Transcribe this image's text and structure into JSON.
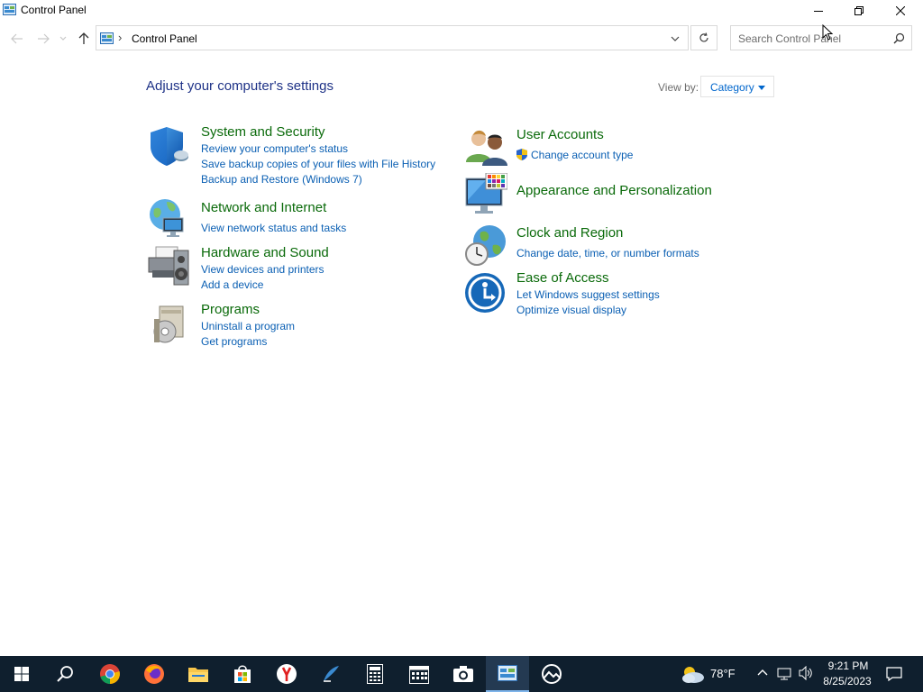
{
  "window": {
    "title": "Control Panel"
  },
  "address": {
    "separator": "›",
    "path": "Control Panel"
  },
  "search": {
    "placeholder": "Search Control Panel"
  },
  "content": {
    "heading": "Adjust your computer's settings",
    "view_by_label": "View by:",
    "view_by_value": "Category"
  },
  "categories": [
    {
      "title": "System and Security",
      "icon": "shield-icon",
      "links": [
        "Review your computer's status",
        "Save backup copies of your files with File History",
        "Backup and Restore (Windows 7)"
      ]
    },
    {
      "title": "Network and Internet",
      "icon": "network-globe-icon",
      "links": [
        "View network status and tasks"
      ]
    },
    {
      "title": "Hardware and Sound",
      "icon": "printer-speaker-icon",
      "links": [
        "View devices and printers",
        "Add a device"
      ]
    },
    {
      "title": "Programs",
      "icon": "programs-disc-icon",
      "links": [
        "Uninstall a program",
        "Get programs"
      ]
    },
    {
      "title": "User Accounts",
      "icon": "users-icon",
      "links": [
        "Change account type"
      ]
    },
    {
      "title": "Appearance and Personalization",
      "icon": "monitor-palette-icon",
      "links": []
    },
    {
      "title": "Clock and Region",
      "icon": "clock-globe-icon",
      "links": [
        "Change date, time, or number formats"
      ]
    },
    {
      "title": "Ease of Access",
      "icon": "ease-of-access-icon",
      "links": [
        "Let Windows suggest settings",
        "Optimize visual display"
      ]
    }
  ],
  "taskbar": {
    "apps": [
      "start-icon",
      "search-icon",
      "chrome-icon",
      "firefox-icon",
      "file-explorer-icon",
      "store-icon",
      "yandex-icon",
      "app-icon",
      "calculator-icon",
      "calendar-icon",
      "camera-icon",
      "control-panel-icon",
      "photos-icon"
    ],
    "weather": "78°F",
    "time": "9:21 PM",
    "date": "8/25/2023"
  },
  "colors": {
    "heading": "#1e3287",
    "category_title": "#0a6a0a",
    "link": "#0a5fb3",
    "taskbar": "#0f1f2e"
  }
}
